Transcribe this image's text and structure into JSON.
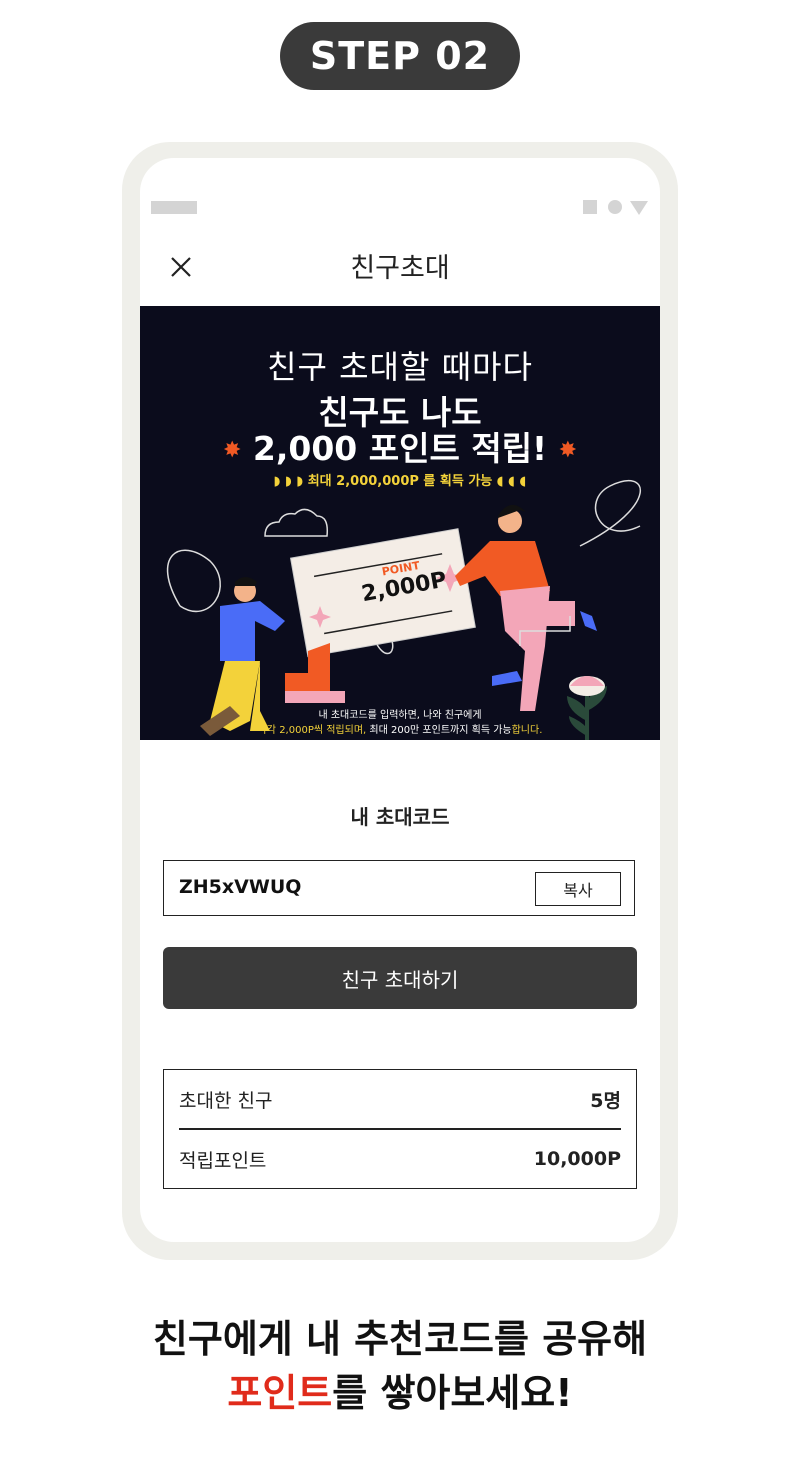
{
  "step_label": "STEP 02",
  "nav": {
    "title": "친구초대",
    "close_icon": "close-icon"
  },
  "banner": {
    "line1": "친구 초대할 때마다",
    "line2": "친구도 나도",
    "line3": "2,000 포인트 적립!",
    "line4": "최대 2,000,000P 를 획득 가능",
    "ticket_label": "POINT",
    "ticket_amount": "2,000P",
    "foot1": "내 초대코드를 입력하면, 나와 친구에게",
    "foot2a": "각각 2,000P씩 적립되며, ",
    "foot2b": "최대 200만 포인트까지 획득 가능",
    "foot2c": "합니다.",
    "accent_color": "#f3d23a",
    "star_color": "#f15a24"
  },
  "invite_code": {
    "section_title": "내 초대코드",
    "code": "ZH5xVWUQ",
    "copy_label": "복사"
  },
  "invite_button_label": "친구 초대하기",
  "stats": {
    "invited_label": "초대한 친구",
    "invited_value": "5명",
    "points_label": "적립포인트",
    "points_value": "10,000P"
  },
  "caption": {
    "line1": "친구에게 내 추천코드를 공유해",
    "line2_highlight": "포인트",
    "line2_rest": "를 쌓아보세요!",
    "highlight_color": "#e02b1b"
  }
}
